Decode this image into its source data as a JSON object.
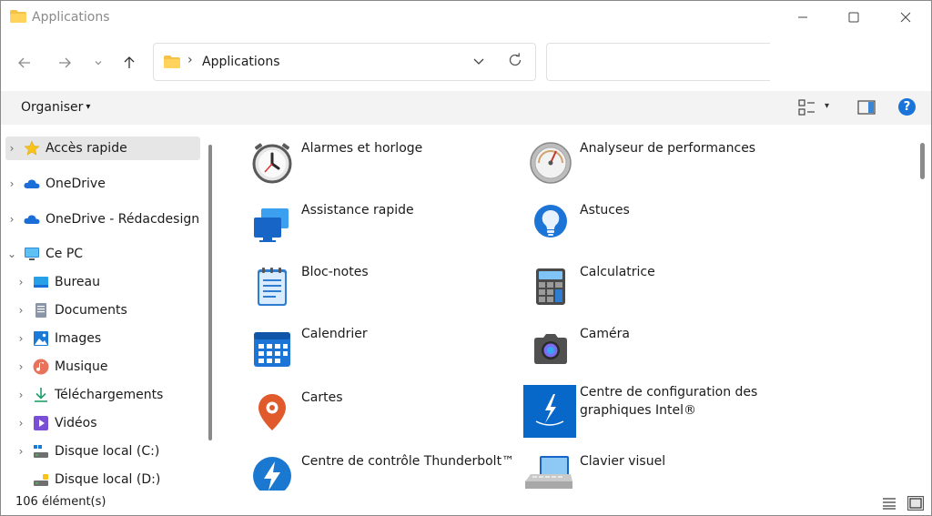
{
  "window": {
    "title": "Applications",
    "controls": {
      "minimize": "—",
      "maximize": "☐",
      "close": "✕"
    }
  },
  "nav": {
    "back": "←",
    "forward": "→",
    "recent": "⌄",
    "up": "↑"
  },
  "address": {
    "separator": "›",
    "path": "Applications",
    "dropdown": "⌄",
    "refresh": "↻"
  },
  "search": {
    "placeholder": ""
  },
  "toolbar": {
    "organiser_label": "Organiser",
    "organiser_caret": "▾",
    "view_caret": "▾",
    "help": "?"
  },
  "sidebar": {
    "items": [
      {
        "label": "Accès rapide",
        "icon": "star-icon",
        "selected": true
      },
      {
        "label": "OneDrive",
        "icon": "cloud-icon"
      },
      {
        "label": "OneDrive - Rédacdesign",
        "icon": "cloud-icon"
      },
      {
        "label": "Ce PC",
        "icon": "computer-icon",
        "expanded": true
      },
      {
        "label": "Bureau",
        "icon": "desktop-icon"
      },
      {
        "label": "Documents",
        "icon": "documents-icon"
      },
      {
        "label": "Images",
        "icon": "images-icon"
      },
      {
        "label": "Musique",
        "icon": "music-icon"
      },
      {
        "label": "Téléchargements",
        "icon": "downloads-icon"
      },
      {
        "label": "Vidéos",
        "icon": "videos-icon"
      },
      {
        "label": "Disque local (C:)",
        "icon": "drive-c-icon"
      },
      {
        "label": "Disque local (D:)",
        "icon": "drive-d-icon"
      }
    ],
    "chevron_right": "›",
    "chevron_down": "⌄"
  },
  "apps": [
    {
      "label": "Alarmes et horloge",
      "icon": "clock-icon"
    },
    {
      "label": "Analyseur de performances",
      "icon": "gauge-icon"
    },
    {
      "label": "Assistance rapide",
      "icon": "quick-assist-icon"
    },
    {
      "label": "Astuces",
      "icon": "lightbulb-icon"
    },
    {
      "label": "Bloc-notes",
      "icon": "notepad-icon"
    },
    {
      "label": "Calculatrice",
      "icon": "calculator-icon"
    },
    {
      "label": "Calendrier",
      "icon": "calendar-icon"
    },
    {
      "label": "Caméra",
      "icon": "camera-icon"
    },
    {
      "label": "Cartes",
      "icon": "map-pin-icon"
    },
    {
      "label": "Centre de configuration des graphiques Intel®",
      "icon": "intel-graphics-icon"
    },
    {
      "label": "Centre de contrôle Thunderbolt™",
      "icon": "thunderbolt-icon"
    },
    {
      "label": "Clavier visuel",
      "icon": "keyboard-icon"
    }
  ],
  "status": {
    "count": "106 élément(s)"
  },
  "colors": {
    "accent": "#1a73d9",
    "folder": "#f5c146",
    "selected_bg": "#e6e6e6",
    "toolbar_bg": "#f3f3f3"
  }
}
